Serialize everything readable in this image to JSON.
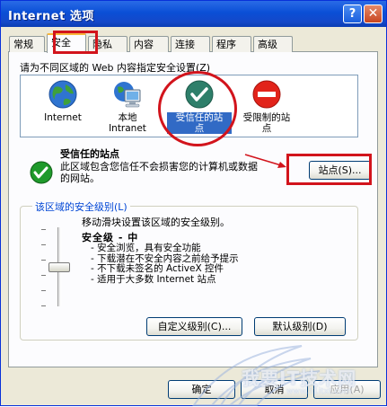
{
  "window": {
    "title": "Internet 选项",
    "help_label": "?",
    "close_label": "✕"
  },
  "tabs": [
    {
      "label": "常规"
    },
    {
      "label": "安全"
    },
    {
      "label": "隐私"
    },
    {
      "label": "内容"
    },
    {
      "label": "连接"
    },
    {
      "label": "程序"
    },
    {
      "label": "高级"
    }
  ],
  "security": {
    "zone_prompt": "请为不同区域的 Web 内容指定安全设置(Z)",
    "zones": [
      {
        "label": "Internet",
        "icon": "globe-icon"
      },
      {
        "label": "本地\nIntranet",
        "icon": "computer-globe-icon"
      },
      {
        "label": "受信任的站\n点",
        "icon": "check-circle-icon",
        "selected": true
      },
      {
        "label": "受限制的站\n点",
        "icon": "no-entry-icon"
      }
    ],
    "zone_heading": "受信任的站点",
    "zone_desc": "此区域包含您信任不会损害您的计算机或数据的网站。",
    "sites_button": "站点(S)...",
    "level_group_label": "该区域的安全级别(L)",
    "slider_help": "移动滑块设置该区域的安全级别。",
    "level_name": "安全级 - 中",
    "level_bullets": [
      "- 安全浏览，具有安全功能",
      "- 下载潜在不安全内容之前给予提示",
      "- 不下载未签名的 ActiveX 控件",
      "- 适用于大多数 Internet 站点"
    ],
    "slider_level": 0.5,
    "custom_button": "自定义级别(C)...",
    "default_button": "默认级别(D)"
  },
  "footer": {
    "ok_button": "确定",
    "cancel_button": "取消",
    "apply_button": "应用(A)"
  },
  "watermark": {
    "text": "我要IT技术网",
    "sub": "www.51itxt.com"
  },
  "colors": {
    "title_blue": "#0a4fd6",
    "selection_blue": "#316ac5",
    "annotation_red": "#d2141c",
    "group_label_blue": "#0046d5"
  }
}
